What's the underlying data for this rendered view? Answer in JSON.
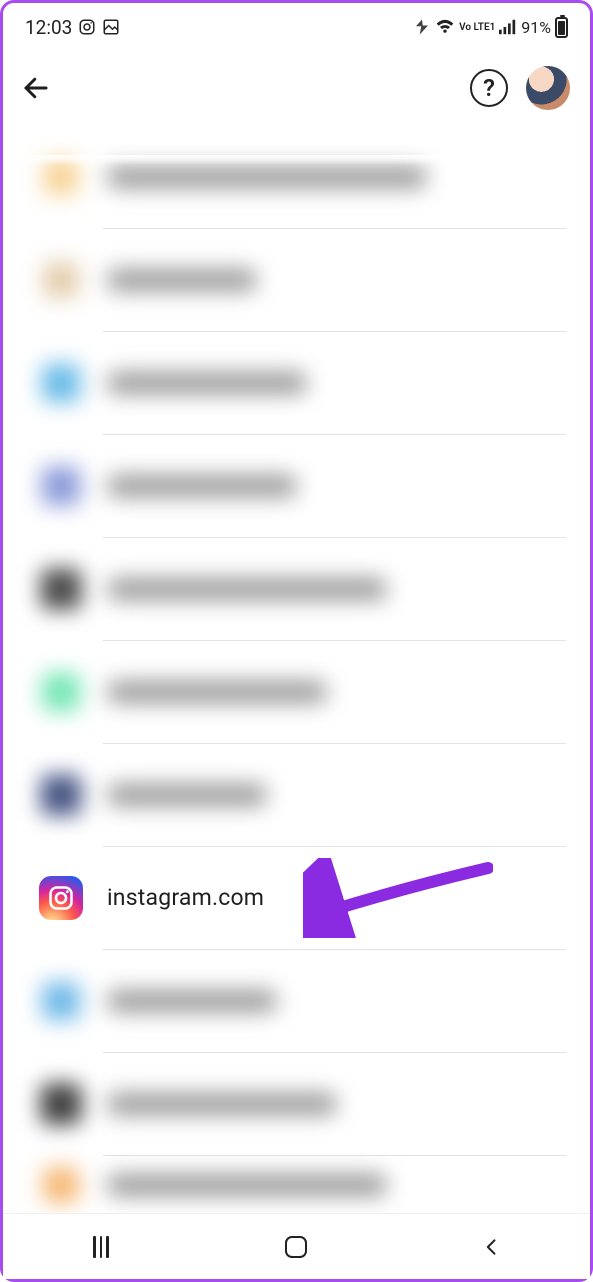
{
  "statusbar": {
    "time": "12:03",
    "network_label": "Vo LTE1",
    "battery_percent": "91%"
  },
  "list": {
    "items": [
      {
        "focused": false
      },
      {
        "focused": false
      },
      {
        "focused": false
      },
      {
        "focused": false
      },
      {
        "focused": false
      },
      {
        "focused": false
      },
      {
        "focused": false
      },
      {
        "label": "instagram.com",
        "focused": true
      },
      {
        "focused": false
      },
      {
        "focused": false
      },
      {
        "focused": false
      }
    ]
  },
  "help_glyph": "?"
}
